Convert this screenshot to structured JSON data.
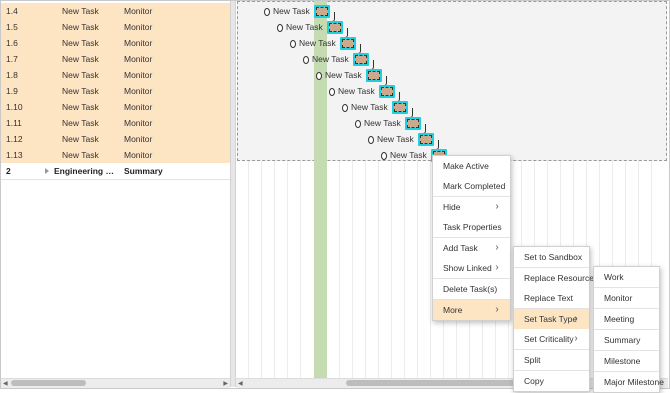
{
  "grid": {
    "rows": [
      {
        "id": "1.4",
        "name": "New Task",
        "type": "Monitor"
      },
      {
        "id": "1.5",
        "name": "New Task",
        "type": "Monitor"
      },
      {
        "id": "1.6",
        "name": "New Task",
        "type": "Monitor"
      },
      {
        "id": "1.7",
        "name": "New Task",
        "type": "Monitor"
      },
      {
        "id": "1.8",
        "name": "New Task",
        "type": "Monitor"
      },
      {
        "id": "1.9",
        "name": "New Task",
        "type": "Monitor"
      },
      {
        "id": "1.10",
        "name": "New Task",
        "type": "Monitor"
      },
      {
        "id": "1.11",
        "name": "New Task",
        "type": "Monitor"
      },
      {
        "id": "1.12",
        "name": "New Task",
        "type": "Monitor"
      },
      {
        "id": "1.13",
        "name": "New Task",
        "type": "Monitor"
      }
    ],
    "summary": {
      "id": "2",
      "name": "Engineering Bu...",
      "type": "Summary"
    }
  },
  "gantt": {
    "task_labels": [
      "New Task",
      "New Task",
      "New Task",
      "New Task",
      "New Task",
      "New Task",
      "New Task",
      "New Task",
      "New Task",
      "New Task"
    ]
  },
  "context_menu": {
    "items": [
      {
        "label": "Make Active",
        "submenu": false
      },
      {
        "label": "Mark Completed",
        "submenu": false
      },
      {
        "label": "Hide",
        "submenu": true
      },
      {
        "label": "Task Properties",
        "submenu": false
      },
      {
        "label": "Add Task",
        "submenu": true
      },
      {
        "label": "Show Linked",
        "submenu": true
      },
      {
        "label": "Delete Task(s)",
        "submenu": false
      },
      {
        "label": "More",
        "submenu": true,
        "highlighted": true
      }
    ]
  },
  "more_menu": {
    "items": [
      {
        "label": "Set to Sandbox",
        "submenu": false
      },
      {
        "label": "Replace Resource",
        "submenu": false
      },
      {
        "label": "Replace Text",
        "submenu": false
      },
      {
        "label": "Set Task Type",
        "submenu": true,
        "highlighted": true
      },
      {
        "label": "Set Criticality",
        "submenu": true
      },
      {
        "label": "Split",
        "submenu": false
      },
      {
        "label": "Copy",
        "submenu": false
      }
    ]
  },
  "task_type_menu": {
    "items": [
      "Work",
      "Monitor",
      "Meeting",
      "Summary",
      "Milestone",
      "Major Milestone"
    ]
  },
  "colors": {
    "selected_row": "#fde5c3",
    "bar_fill": "#cca98c",
    "bar_border": "#1ed0de",
    "today_band": "#c5dcb2"
  }
}
